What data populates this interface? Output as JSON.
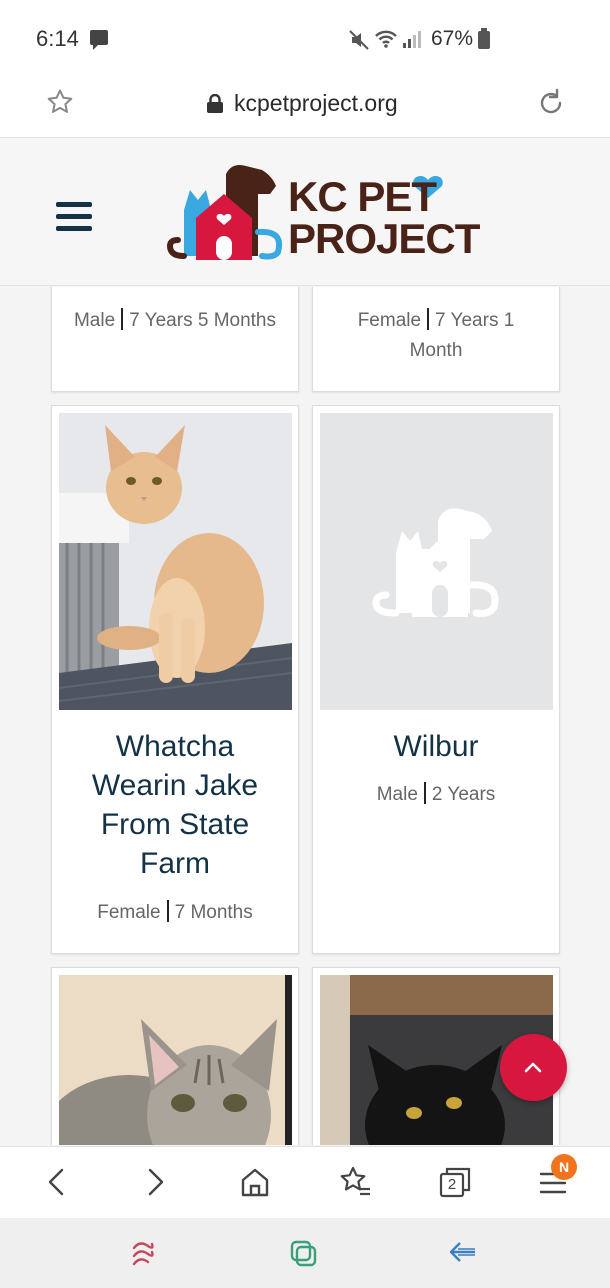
{
  "status_bar": {
    "time": "6:14",
    "battery_percent": "67%",
    "icons": [
      "message-icon",
      "mute-icon",
      "wifi-icon",
      "signal-icon",
      "battery-icon"
    ]
  },
  "browser": {
    "url": "kcpetproject.org",
    "tab_count": "2",
    "menu_badge": "N"
  },
  "site": {
    "logo_line1": "KC PET",
    "logo_line2": "PROJECT",
    "colors": {
      "brand_red": "#d8173f",
      "brand_blue": "#3aa8e0",
      "brand_brown": "#4a2318",
      "navy": "#143246"
    }
  },
  "pets": [
    {
      "name": "",
      "sex": "Male",
      "age": "7 Years 5 Months",
      "photo": "none"
    },
    {
      "name": "",
      "sex": "Female",
      "age_line1": "7 Years 1",
      "age_line2": "Month",
      "photo": "none"
    },
    {
      "name_lines": [
        "Whatcha",
        "Wearin Jake",
        "From State",
        "Farm"
      ],
      "sex": "Female",
      "age": "7 Months",
      "photo": "orange-cat"
    },
    {
      "name": "Wilbur",
      "sex": "Male",
      "age": "2 Years",
      "photo": "placeholder-logo"
    },
    {
      "name": "",
      "sex": "",
      "age": "",
      "photo": "tabby-cat"
    },
    {
      "name": "",
      "sex": "",
      "age": "",
      "photo": "black-cat"
    }
  ]
}
